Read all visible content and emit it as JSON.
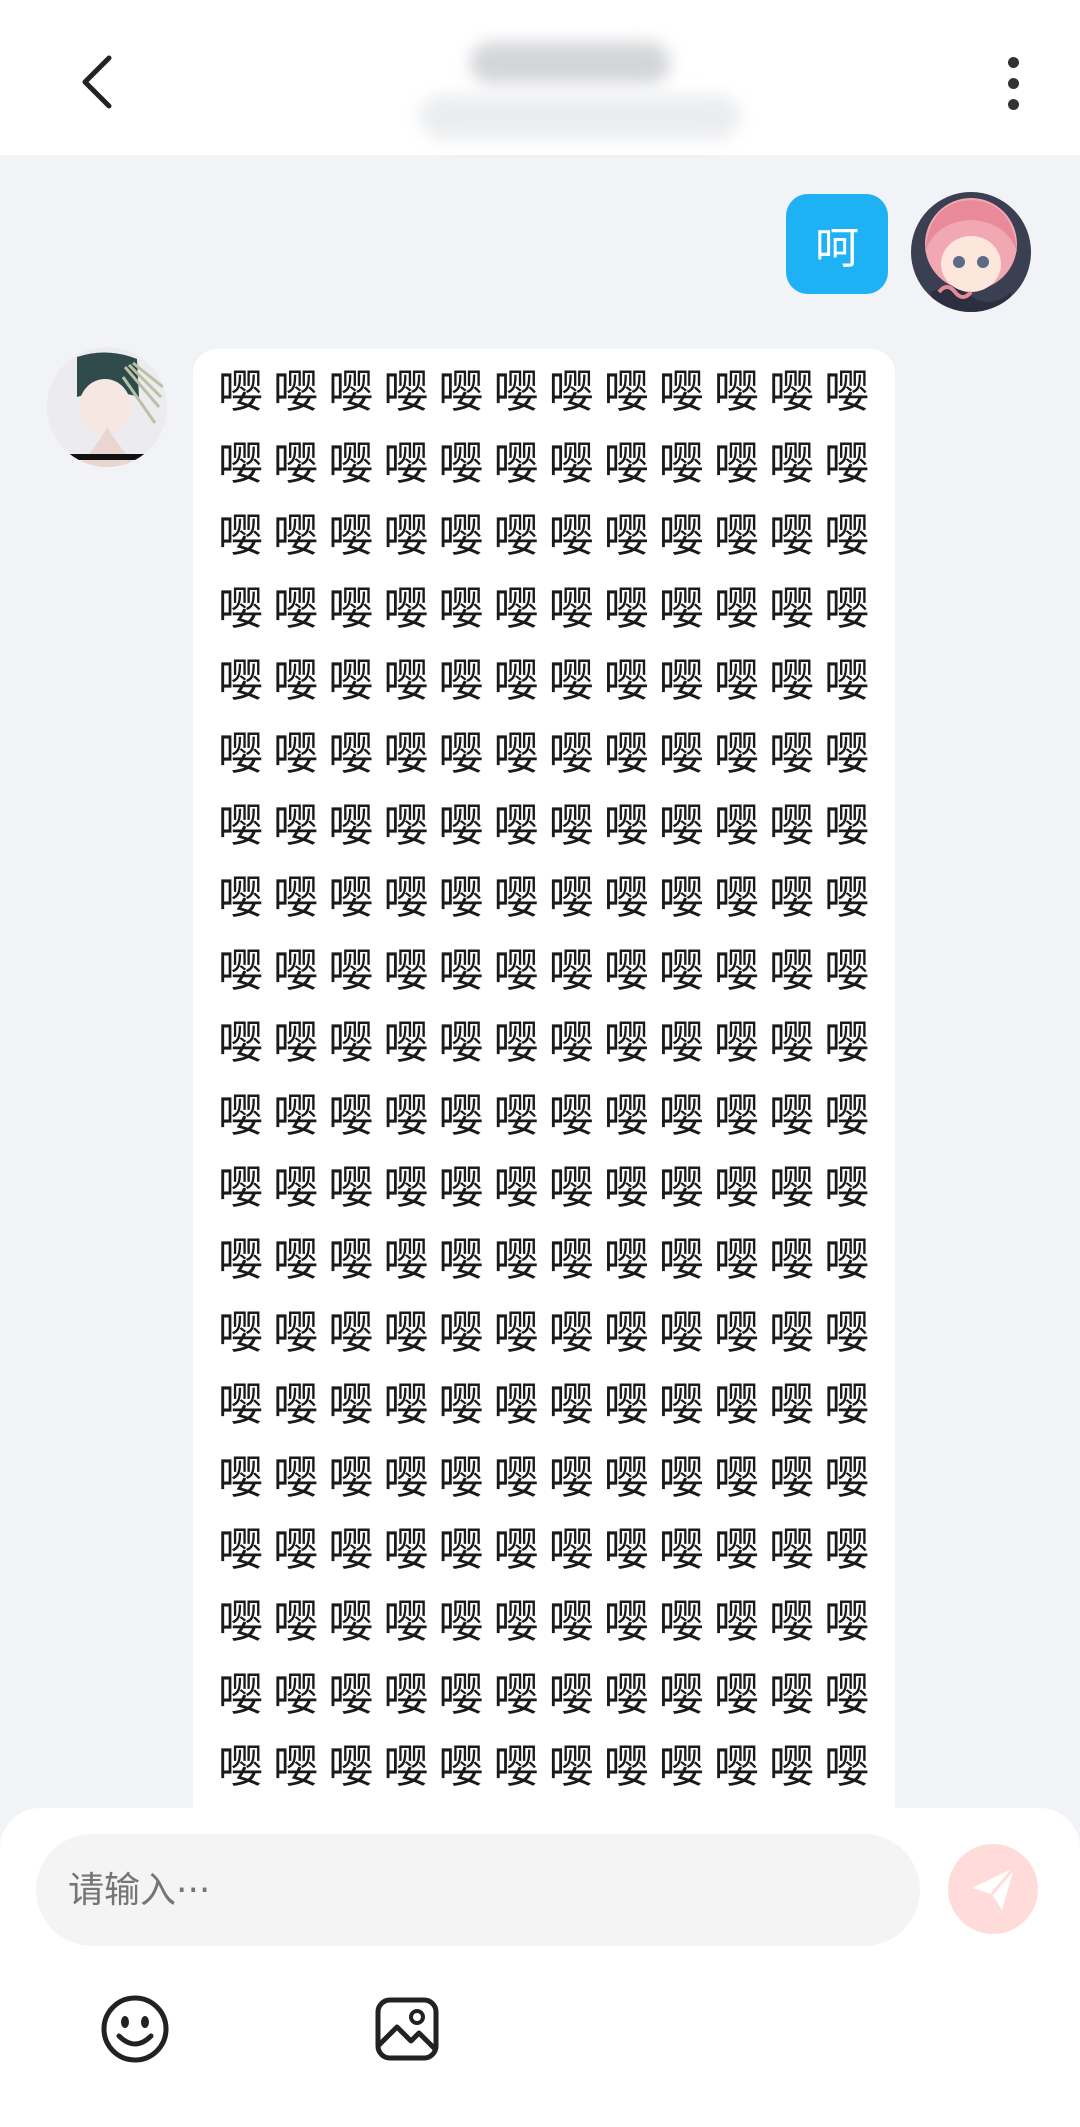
{
  "header": {
    "back_icon": "chevron-left-icon",
    "more_icon": "more-vertical-icon"
  },
  "messages": [
    {
      "sender": "me",
      "text": "呵"
    },
    {
      "sender": "other",
      "char": "嘤",
      "rows": 20,
      "cols": 12
    }
  ],
  "input": {
    "placeholder": "请输入···",
    "value": ""
  },
  "colors": {
    "my_bubble": "#1eb1f4",
    "send_button": "#ffdcd9",
    "background": "#f1f3f6"
  },
  "toolbar": {
    "emoji_icon": "smiley-icon",
    "image_icon": "image-icon",
    "send_icon": "paper-plane-icon"
  }
}
